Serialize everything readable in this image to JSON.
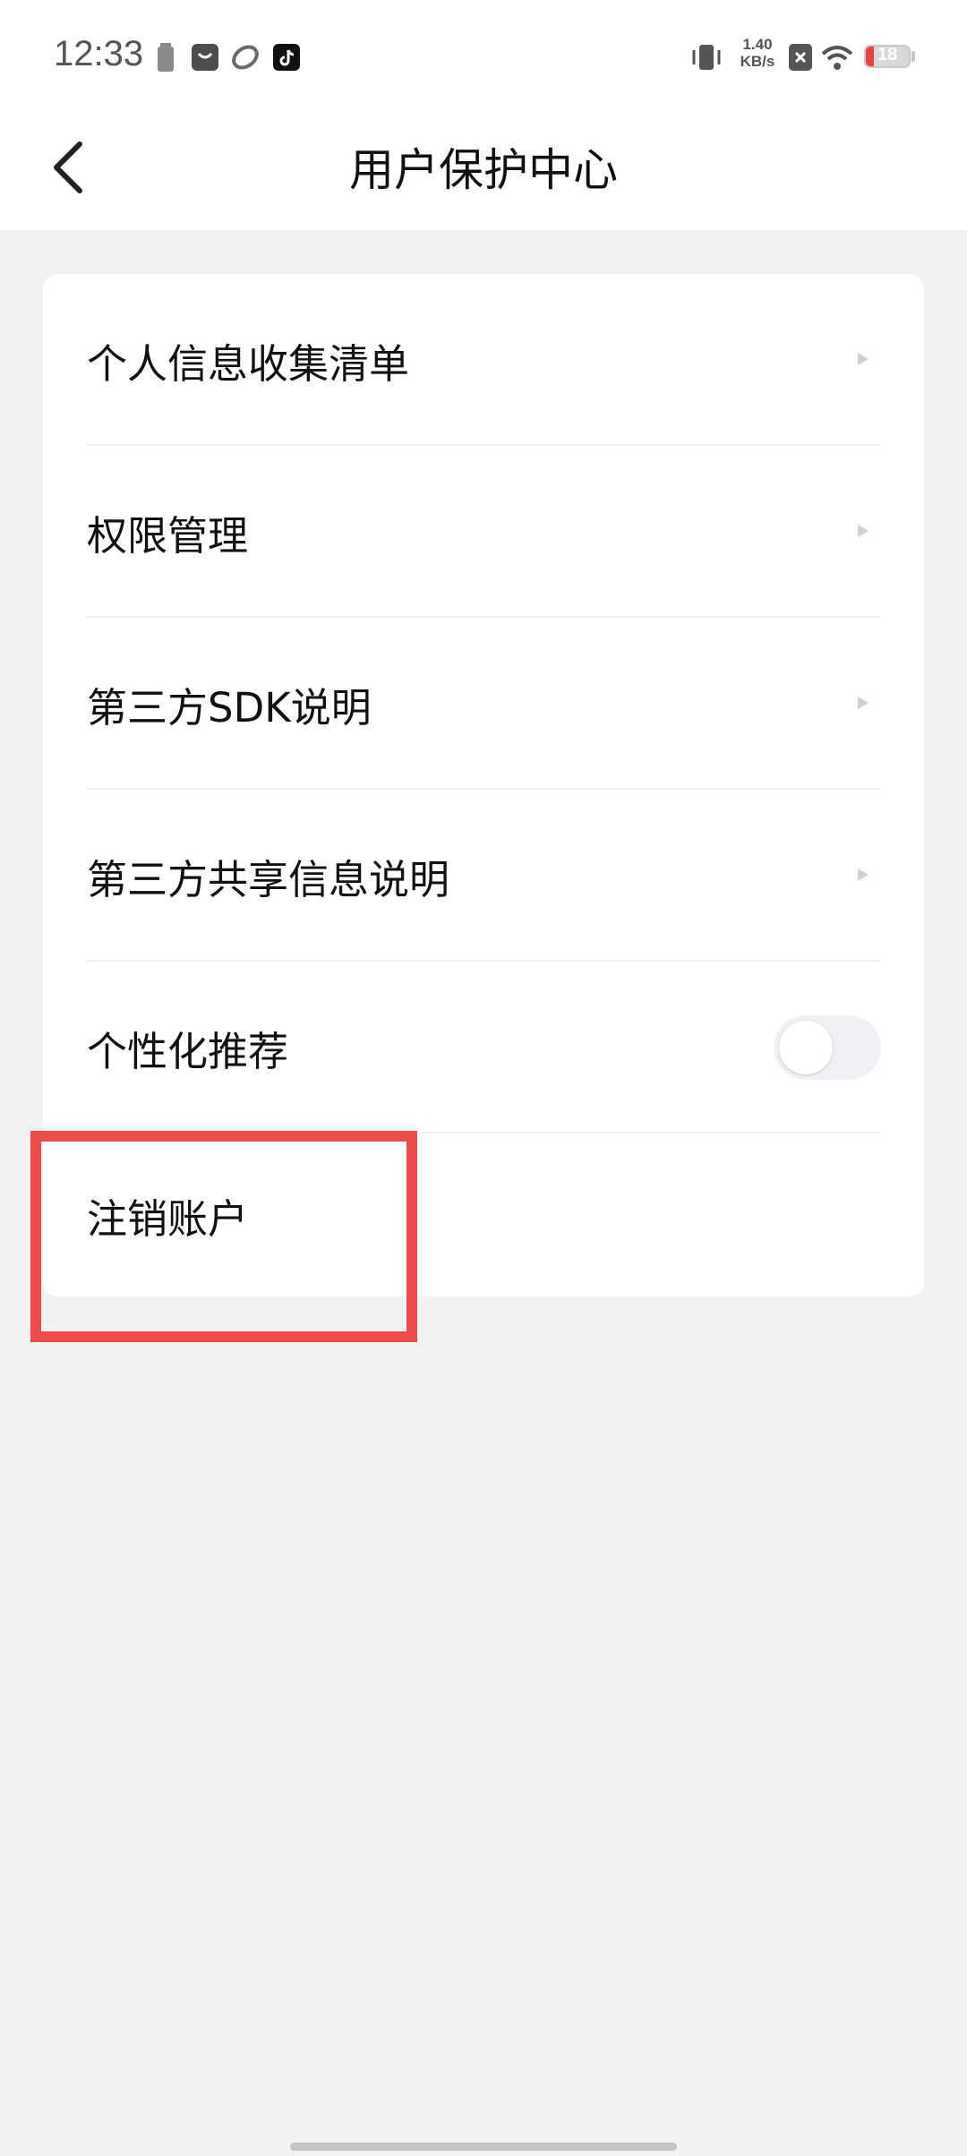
{
  "status_bar": {
    "time": "12:33",
    "net_speed_value": "1.40",
    "net_speed_unit": "KB/s",
    "battery_level": "18",
    "battery_fraction": 0.18,
    "icons": [
      "battery-saver-icon",
      "shopping-bag-icon",
      "sync-app-icon",
      "tiktok-icon",
      "vibrate-icon",
      "sim-x-icon",
      "wifi-icon",
      "battery-icon"
    ]
  },
  "header": {
    "title": "用户保护中心",
    "back_icon": "chevron-left-icon"
  },
  "menu": {
    "items": [
      {
        "label": "个人信息收集清单",
        "type": "link"
      },
      {
        "label": "权限管理",
        "type": "link"
      },
      {
        "label": "第三方SDK说明",
        "type": "link"
      },
      {
        "label": "第三方共享信息说明",
        "type": "link"
      },
      {
        "label": "个性化推荐",
        "type": "toggle",
        "checked": false
      },
      {
        "label": "注销账户",
        "type": "link"
      }
    ]
  },
  "colors": {
    "highlight": "#ee4c4c",
    "background": "#f2f2f3",
    "card": "#ffffff"
  }
}
